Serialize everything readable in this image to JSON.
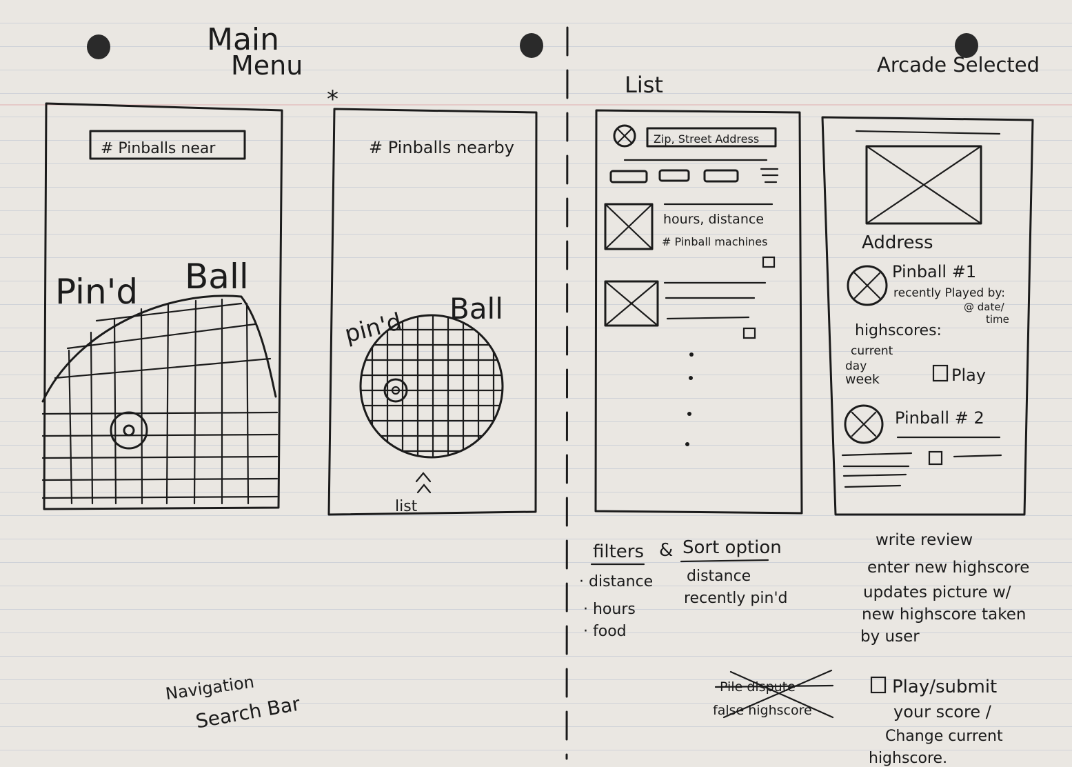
{
  "titles": {
    "main_menu_line1": "Main",
    "main_menu_line2": "Menu",
    "asterisk": "*",
    "list": "List",
    "arcade_selected": "Arcade Selected"
  },
  "screen1": {
    "search_box": "# Pinballs near",
    "logo_left": "Pin'd",
    "logo_right": "Ball"
  },
  "screen2": {
    "header": "# Pinballs nearby",
    "logo_left": "pin'd",
    "logo_right": "Ball",
    "swipe_label": "list"
  },
  "screen3": {
    "search_box": "Zip, Street Address",
    "item1_line1": "hours, distance",
    "item1_line2": "# Pinball machines"
  },
  "screen4": {
    "address": "Address",
    "pinball1_name": "Pinball #1",
    "recently_played": "recently Played by:",
    "at_date": "@ date/",
    "time": "time",
    "highscores": "highscores:",
    "current": "current",
    "day": "day",
    "week": "week",
    "play": "Play",
    "pinball2_name": "Pinball # 2"
  },
  "notes": {
    "nav_line1": "Navigation",
    "nav_line2": "Search Bar",
    "filters_header": "filters",
    "amp": "&",
    "sort_header": "Sort option",
    "filter_items": [
      "· distance",
      "· hours",
      "· food"
    ],
    "sort_items": [
      "distance",
      "recently pin'd"
    ],
    "crossed_line1": "Pile dispute",
    "crossed_line2": "false highscore",
    "review_lines": [
      "write review",
      "enter new highscore",
      "updates picture w/",
      "new highscore taken",
      "by user"
    ],
    "play_note_lines": [
      "Play/submit",
      "your score /",
      "Change current",
      "highscore."
    ]
  }
}
